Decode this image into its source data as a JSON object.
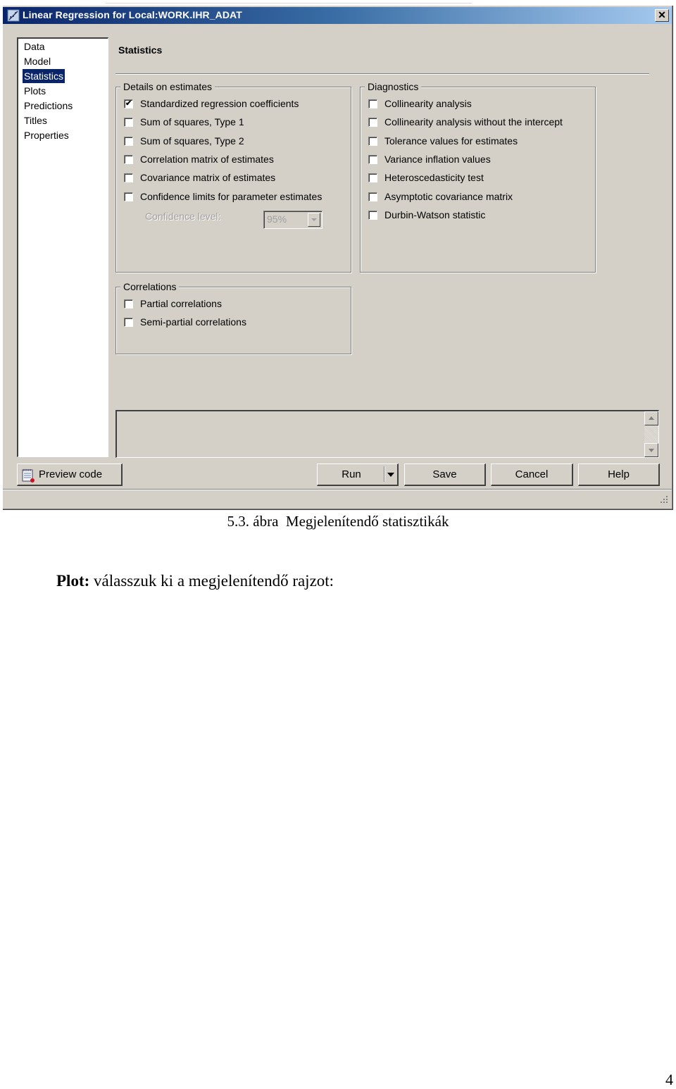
{
  "window": {
    "title": "Linear Regression for Local:WORK.IHR_ADAT",
    "close_label": "✕",
    "title_gradient": [
      "#0a246a",
      "#3a6ea5",
      "#a6caf0"
    ]
  },
  "nav": {
    "items": [
      {
        "label": "Data",
        "selected": false
      },
      {
        "label": "Model",
        "selected": false
      },
      {
        "label": "Statistics",
        "selected": true
      },
      {
        "label": "Plots",
        "selected": false
      },
      {
        "label": "Predictions",
        "selected": false
      },
      {
        "label": "Titles",
        "selected": false
      },
      {
        "label": "Properties",
        "selected": false
      }
    ],
    "selected_color": "#0a246a"
  },
  "panel": {
    "title": "Statistics",
    "details": {
      "legend": "Details on estimates",
      "options": [
        {
          "label": "Standardized regression coefficients",
          "checked": true
        },
        {
          "label": "Sum of squares, Type 1",
          "checked": false
        },
        {
          "label": "Sum of squares, Type 2",
          "checked": false
        },
        {
          "label": "Correlation matrix of estimates",
          "checked": false
        },
        {
          "label": "Covariance matrix of estimates",
          "checked": false
        },
        {
          "label": "Confidence limits for parameter estimates",
          "checked": false
        }
      ],
      "confidence_level_label": "Confidence level:",
      "confidence_level_value": "95%",
      "confidence_level_enabled": false
    },
    "diagnostics": {
      "legend": "Diagnostics",
      "options": [
        {
          "label": "Collinearity analysis",
          "checked": false
        },
        {
          "label": "Collinearity analysis without the intercept",
          "checked": false
        },
        {
          "label": "Tolerance values for estimates",
          "checked": false
        },
        {
          "label": "Variance inflation values",
          "checked": false
        },
        {
          "label": "Heteroscedasticity test",
          "checked": false
        },
        {
          "label": "Asymptotic covariance matrix",
          "checked": false
        },
        {
          "label": "Durbin-Watson statistic",
          "checked": false
        }
      ]
    },
    "correlations": {
      "legend": "Correlations",
      "options": [
        {
          "label": "Partial correlations",
          "checked": false
        },
        {
          "label": "Semi-partial correlations",
          "checked": false
        }
      ]
    },
    "message_area": ""
  },
  "buttons": {
    "preview_code": "Preview code",
    "run": "Run",
    "save": "Save",
    "cancel": "Cancel",
    "help": "Help"
  },
  "document": {
    "caption_number": "5.3. ábra",
    "caption_text": "Megjelenítendő statisztikák",
    "para_bold": "Plot:",
    "para_text": " válasszuk ki a megjelenítendő rajzot:",
    "page_number": "4"
  }
}
